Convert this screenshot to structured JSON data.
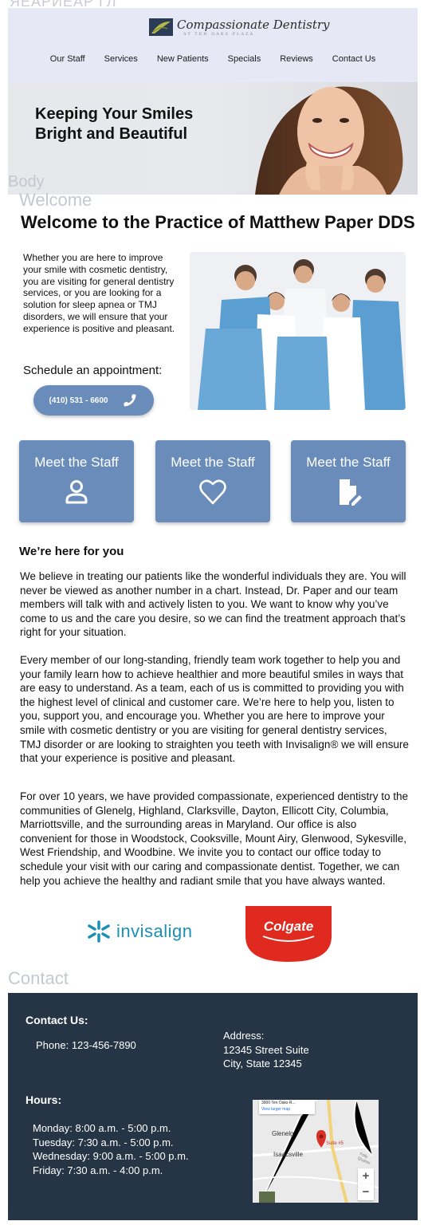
{
  "top_label": "ЯЕАРИЕАР ГЛ",
  "header": {
    "logo": {
      "name": "Compassionate Dentistry",
      "subtitle": "AT TEN OAKS PLAZA"
    },
    "nav": [
      "Our Staff",
      "Services",
      "New Patients",
      "Specials",
      "Reviews",
      "Contact Us"
    ]
  },
  "hero": {
    "title": "Keeping Your Smiles Bright and Beautiful"
  },
  "section_labels": {
    "body": "Body",
    "welcome": "Welcome",
    "contact": "Contact"
  },
  "welcome": {
    "title": "Welcome to the Practice of Matthew Paper DDS",
    "intro": "Whether you are here to improve your smile with cosmetic dentistry, you are visiting for general dentistry services, or you are looking for a solution for sleep apnea or TMJ disorders, we will ensure that your experience is positive and pleasant.",
    "schedule_label": "Schedule an appointment:",
    "phone": "(410) 531 - 6600"
  },
  "cards": [
    {
      "title": "Meet the Staff",
      "icon": "person-icon"
    },
    {
      "title": "Meet the Staff",
      "icon": "heart-icon"
    },
    {
      "title": "Meet the Staff",
      "icon": "file-edit-icon"
    }
  ],
  "here_for_you": {
    "heading": "We’re here for you",
    "paragraphs": [
      "We believe in treating our patients like the wonderful individuals they are. You will never be viewed as another number in a chart. Instead, Dr. Paper and our team members will talk with and actively listen to you. We want to know why you’ve come to us and the care you desire, so we can find the treatment approach that’s right for your situation.",
      "Every member of our long-standing, friendly team work together to help you and your family learn how to achieve healthier and more beautiful smiles in ways that are easy to understand. As a team, each of us is committed to providing you with the highest level of clinical and customer care. We’re here to help you, listen to you, support you, and encourage you. Whether you are here to improve your smile with cosmetic dentistry or you are visiting for general dentistry services, TMJ  disorder or are looking to straighten you teeth with Invisalign®  we will ensure that your experience is positive and pleasant.",
      "For over 10 years, we have provided compassionate, experienced dentistry to the communities of Glenelg, Highland, Clarksville, Dayton, Ellicott City, Columbia, Marriottsville, and the surrounding areas in Maryland. Our office is also convenient for those in Woodstock, Cooksville, Mount Airy, Glenwood, Sykesville, West Friendship, and Woodbine. We invite you to contact our office today to schedule your visit with our caring and compassionate dentist. Together, we can help you achieve the healthy and radiant smile that you have always wanted."
    ]
  },
  "partners": {
    "invisalign": "invisalign",
    "colgate": "Colgate"
  },
  "footer": {
    "contact_heading": "Contact Us:",
    "phone": "Phone: 123-456-7890",
    "address": [
      "Address:",
      "12345 Street Suite",
      "City, State 12345"
    ],
    "hours_heading": "Hours:",
    "hours": [
      "Monday: 8:00 a.m. - 5:00 p.m.",
      "Tuesday: 7:30 a.m. - 5:00 p.m.",
      "Wednesday: 9:00 a.m. - 5:00 p.m.",
      "Friday: 7:30 a.m. - 4:00 p.m."
    ],
    "map": {
      "place": "3900 Ten Oaks R...",
      "link": "View larger map",
      "label_glenelg": "Glenelg",
      "label_isaacsville": "Isaacsville",
      "label_suite": "Suite #5",
      "label_road": "Folly Quarter",
      "zoom_in": "+",
      "zoom_out": "−"
    }
  },
  "colors": {
    "header_bg": "#e6e9f5",
    "accent": "#6a8cbb",
    "footer_bg": "#253545",
    "invisalign": "#1c8fb9",
    "colgate": "#e0291f"
  }
}
